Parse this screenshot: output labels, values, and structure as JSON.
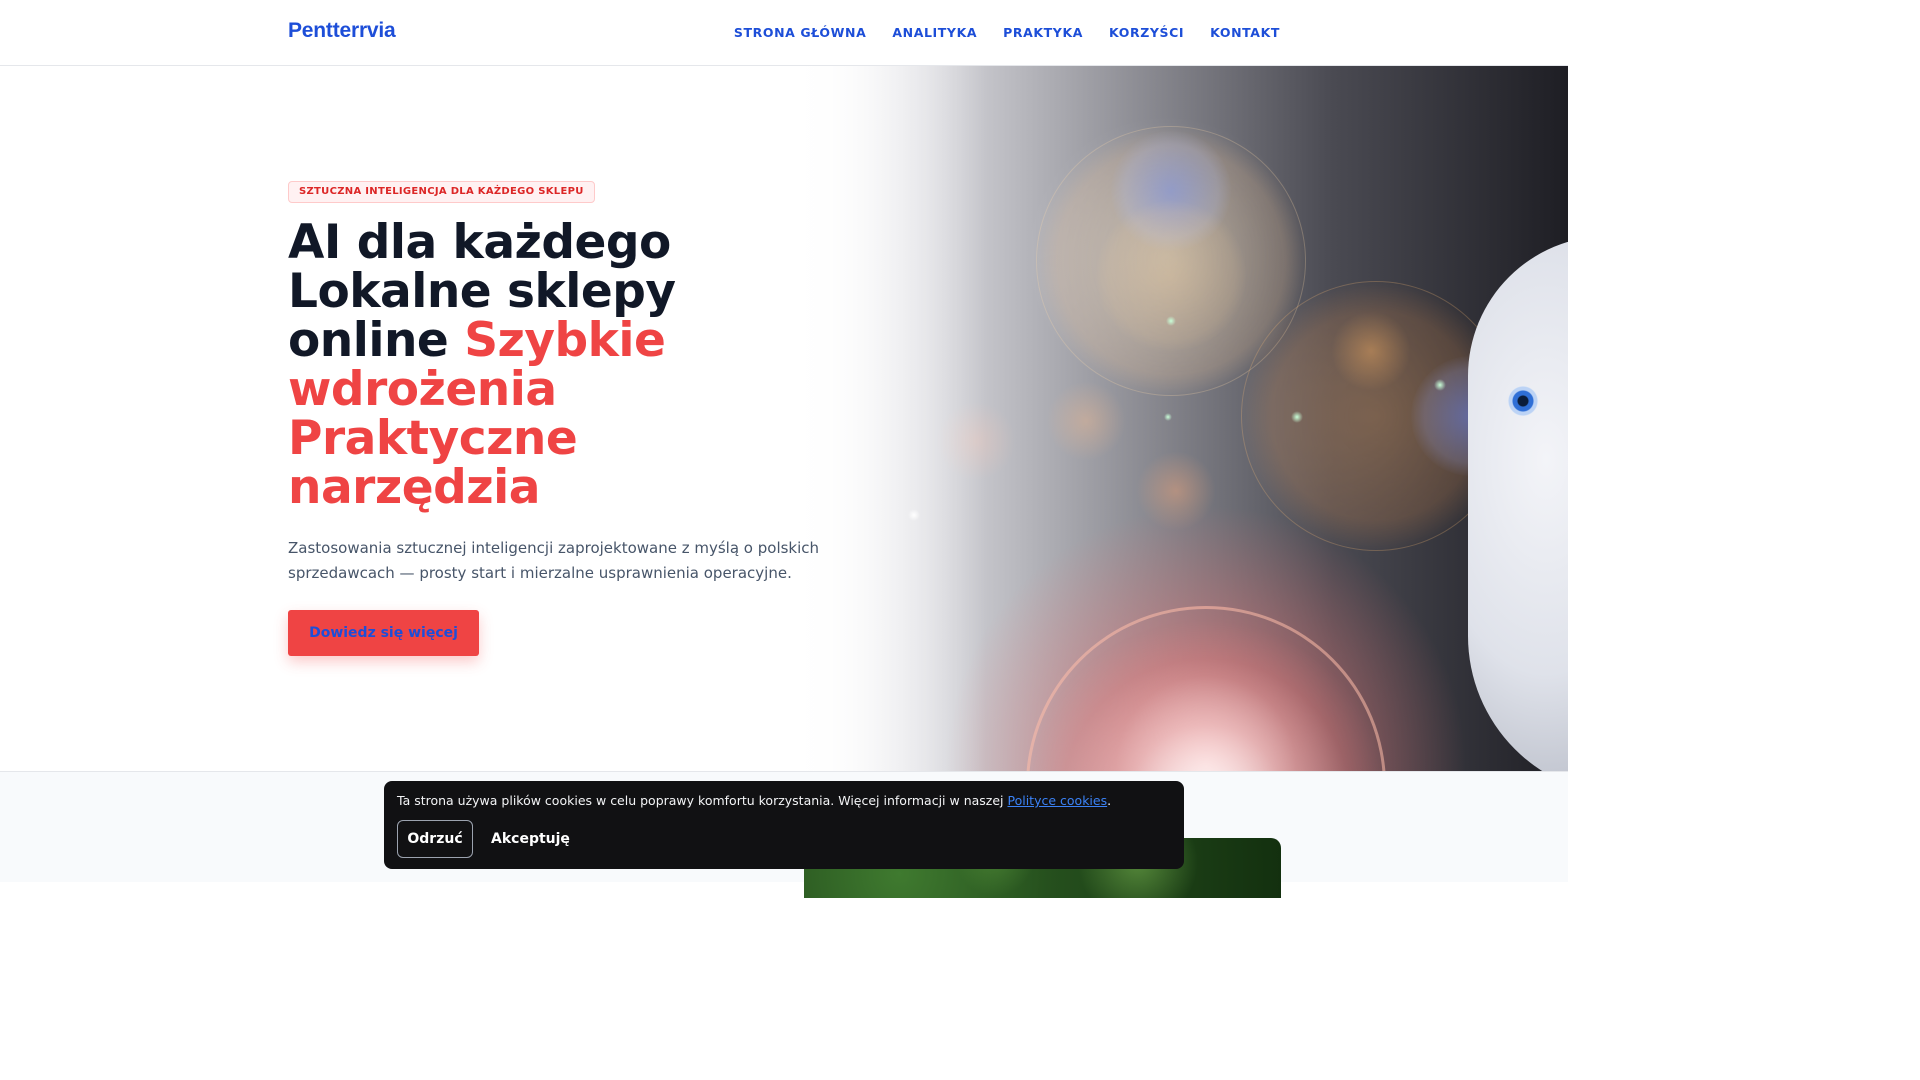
{
  "header": {
    "logo": "Pentterrvia",
    "nav": [
      "STRONA GŁÓWNA",
      "ANALITYKA",
      "PRAKTYKA",
      "KORZYŚCI",
      "KONTAKT"
    ]
  },
  "hero": {
    "badge": "SZTUCZNA INTELIGENCJA DLA KAŻDEGO SKLEPU",
    "title_dark": "AI dla każdego Lokalne sklepy online",
    "title_red": "Szybkie wdrożenia Praktyczne narzędzia",
    "description": "Zastosowania sztucznej inteligencji zaprojektowane z myślą o polskich sprzedawcach — prosty start i mierzalne usprawnienia operacyjne.",
    "cta": "Dowiedz się więcej"
  },
  "cookie_banner": {
    "text": "Ta strona używa plików cookies w celu poprawy komfortu korzystania. Więcej informacji w naszej",
    "link": "Polityce cookies",
    "text_end": ".",
    "reject": "Odrzuć",
    "accept": "Akceptuję"
  },
  "colors": {
    "brand_blue": "#1d4ed8",
    "accent_red": "#ef4444",
    "dark_text": "#111827"
  }
}
